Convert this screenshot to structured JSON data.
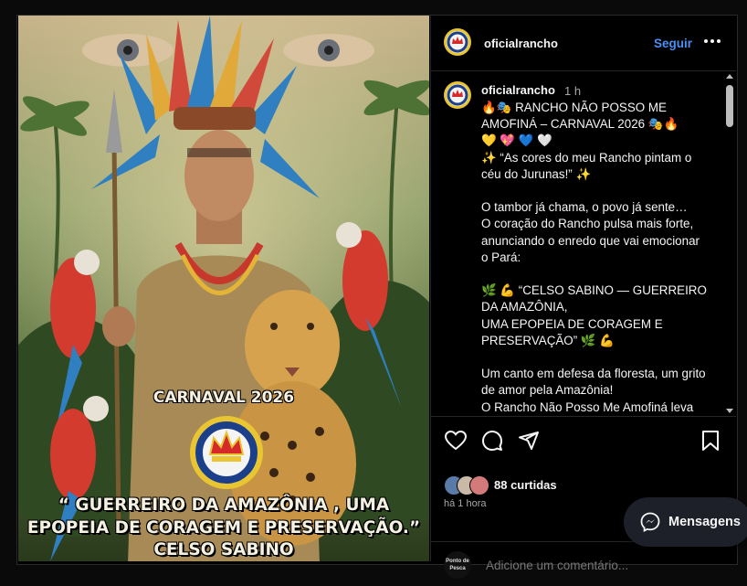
{
  "post": {
    "username": "oficialrancho",
    "follow_label": "Seguir",
    "more_icon": "more-dots-icon"
  },
  "image": {
    "alt_title": "CARNAVAL 2026",
    "subtitle_line1": "“ GUERREIRO DA AMAZÔNIA , UMA",
    "subtitle_line2": "EPOPEIA DE CORAGEM E PRESERVAÇÃO.”",
    "subtitle_line3": "CELSO SABINO",
    "seal_ring_text": "RANCHO NÃO POSSO ME AMOFINÁ",
    "seal_year": "1934"
  },
  "caption": {
    "username": "oficialrancho",
    "time": "1 h",
    "text": "🔥🎭 RANCHO NÃO POSSO ME AMOFINÁ – CARNAVAL 2026 🎭🔥\n💛 💖 💙 🤍\n✨ “As cores do meu Rancho pintam o céu do Jurunas!” ✨\n\nO tambor já chama, o povo já sente…\nO coração do Rancho pulsa mais forte, anunciando o enredo que vai emocionar o Pará:\n\n🌿 💪 “CELSO SABINO — GUERREIRO DA AMAZÔNIA,\nUMA EPOPEIA DE CORAGEM E PRESERVAÇÃO” 🌿 💪\n\nUm canto em defesa da floresta, um grito de amor pela Amazônia!\nO Rancho Não Posso Me Amofiná leva tempo e eterniza poesia..."
  },
  "actions": {
    "likes": "88 curtidas",
    "time": "há 1 hora",
    "comment_placeholder": "Adicione um comentário...",
    "commenter_avatar_text": "Ponto de Pesca"
  },
  "messages": {
    "label": "Mensagens"
  }
}
